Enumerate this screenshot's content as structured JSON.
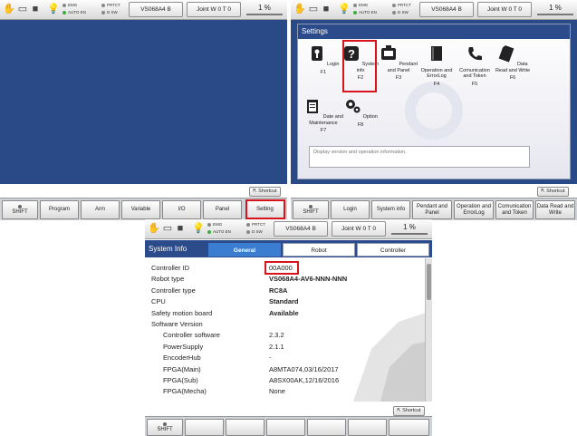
{
  "statusbar": {
    "emg": "EMG",
    "protect": "PRTCT",
    "auto_en": "AUTO EN",
    "dsw": "D SW",
    "robot_model": "VS068A4 B",
    "joint": "Joint W 0 T 0",
    "speed": "1 %"
  },
  "shortcut_label": "Shortcut",
  "main_fkeys": [
    "SHIFT",
    "Program",
    "Arm",
    "Variable",
    "I/O",
    "Panel",
    "Setting"
  ],
  "settings": {
    "title": "Settings",
    "items": [
      {
        "label": "Login",
        "key": "F1",
        "icon": "key-icon"
      },
      {
        "label": "System info",
        "key": "F2",
        "icon": "question-icon"
      },
      {
        "label": "Pendant and Panel",
        "key": "F3",
        "icon": "pendant-icon"
      },
      {
        "label": "Operation and ErrorLog",
        "key": "F4",
        "icon": "book-icon"
      },
      {
        "label": "Comunication and Token",
        "key": "F5",
        "icon": "phone-icon"
      },
      {
        "label": "Data Read and Write",
        "key": "F6",
        "icon": "memory-card-icon"
      },
      {
        "label": "Date and Maintenance",
        "key": "F7",
        "icon": "clipboard-icon"
      },
      {
        "label": "Option",
        "key": "F8",
        "icon": "gears-icon"
      }
    ],
    "info_text": "Display version and operation information."
  },
  "settings_fkeys": [
    "SHIFT",
    "Login",
    "System info",
    "Pendant and Panel",
    "Operation and ErrorLog",
    "Comunication and Token",
    "Data Read and Write"
  ],
  "sysinfo": {
    "title": "System Info",
    "tabs": [
      "General",
      "Robot",
      "Controller"
    ],
    "rows": [
      {
        "label": "Controller ID",
        "value": "00A000",
        "bold": false,
        "indent": false
      },
      {
        "label": "Robot type",
        "value": "VS068A4-AV6-NNN-NNN",
        "bold": true,
        "indent": false
      },
      {
        "label": "Controller type",
        "value": "RC8A",
        "bold": true,
        "indent": false
      },
      {
        "label": "CPU",
        "value": "Standard",
        "bold": true,
        "indent": false
      },
      {
        "label": "Safety motion board",
        "value": "Available",
        "bold": true,
        "indent": false
      },
      {
        "label": "Software Version",
        "value": "",
        "bold": false,
        "indent": false
      },
      {
        "label": "Controller software",
        "value": "2.3.2",
        "bold": false,
        "indent": true
      },
      {
        "label": "PowerSupply",
        "value": "2.1.1",
        "bold": false,
        "indent": true
      },
      {
        "label": "EncoderHub",
        "value": "-",
        "bold": false,
        "indent": true
      },
      {
        "label": "FPGA(Main)",
        "value": "A8MTA074,03/16/2017",
        "bold": false,
        "indent": true
      },
      {
        "label": "FPGA(Sub)",
        "value": "A8SX00AK,12/16/2016",
        "bold": false,
        "indent": true
      },
      {
        "label": "FPGA(Mecha)",
        "value": "None",
        "bold": false,
        "indent": true
      }
    ]
  },
  "sysinfo_fkeys": [
    "SHIFT",
    "",
    "",
    "",
    "",
    "",
    "",
    ""
  ],
  "colors": {
    "panel_blue": "#294a86",
    "header_blue": "#2b4b8a",
    "tab_active": "#3b7dd1",
    "highlight_red": "#d7141d"
  }
}
